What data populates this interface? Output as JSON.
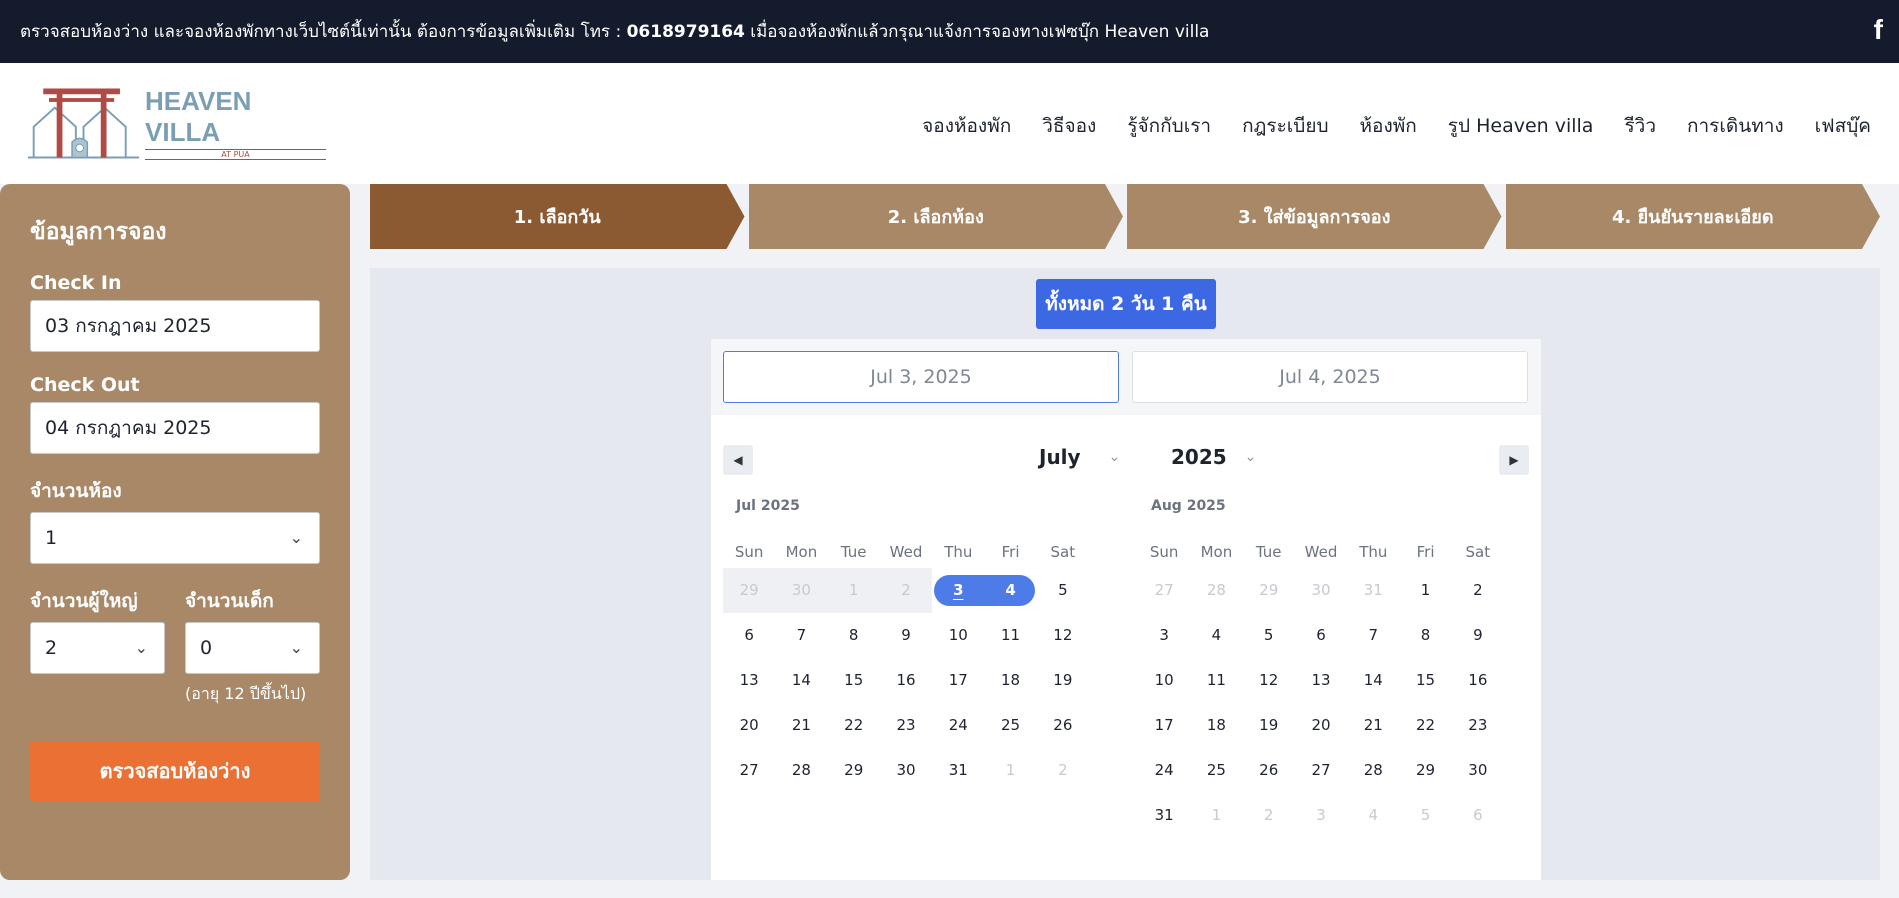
{
  "topbar": {
    "notice_prefix": "ตรวจสอบห้องว่าง และจองห้องพักทางเว็บไซต์นี้เท่านั้น ต้องการข้อมูลเพิ่มเติม โทร : ",
    "phone": "0618979164",
    "notice_suffix": " เมื่อจองห้องพักแล้วกรุณาแจ้งการจองทางเฟซบุ๊ก Heaven villa",
    "facebook_icon": "f"
  },
  "logo": {
    "title": "HEAVEN VILLA",
    "subtitle": "AT PUA"
  },
  "nav": [
    "จองห้องพัก",
    "วิธีจอง",
    "รู้จักกับเรา",
    "กฎระเบียบ",
    "ห้องพัก",
    "รูป Heaven villa",
    "รีวิว",
    "การเดินทาง",
    "เฟสบุ๊ค"
  ],
  "sidebar": {
    "title": "ข้อมูลการจอง",
    "checkin_label": "Check In",
    "checkin_value": "03 กรกฎาคม 2025",
    "checkout_label": "Check Out",
    "checkout_value": "04 กรกฎาคม 2025",
    "rooms_label": "จำนวนห้อง",
    "rooms_value": "1",
    "adults_label": "จำนวนผู้ใหญ่",
    "adults_value": "2",
    "children_label": "จำนวนเด็ก",
    "children_value": "0",
    "age_note": "(อายุ 12 ปีขึ้นไป)",
    "check_button": "ตรวจสอบห้องว่าง"
  },
  "steps": [
    "1. เลือกวัน",
    "2. เลือกห้อง",
    "3. ใส่ข้อมูลการจอง",
    "4. ยืนยันรายละเอียด"
  ],
  "active_step": 0,
  "booking": {
    "nights_badge": "ทั้งหมด 2 วัน 1 คืน",
    "start_input": "Jul 3, 2025",
    "end_input": "Jul 4, 2025"
  },
  "calendar": {
    "month_select": "July",
    "year_select": "2025",
    "dow": [
      "Sun",
      "Mon",
      "Tue",
      "Wed",
      "Thu",
      "Fri",
      "Sat"
    ],
    "months": [
      {
        "title": "Jul 2025",
        "weeks": [
          [
            {
              "d": "29",
              "s": "past"
            },
            {
              "d": "30",
              "s": "past"
            },
            {
              "d": "1",
              "s": "past"
            },
            {
              "d": "2",
              "s": "past"
            },
            {
              "d": "3",
              "s": "selstart"
            },
            {
              "d": "4",
              "s": "selend"
            },
            {
              "d": "5",
              "s": ""
            }
          ],
          [
            {
              "d": "6",
              "s": ""
            },
            {
              "d": "7",
              "s": ""
            },
            {
              "d": "8",
              "s": ""
            },
            {
              "d": "9",
              "s": ""
            },
            {
              "d": "10",
              "s": ""
            },
            {
              "d": "11",
              "s": ""
            },
            {
              "d": "12",
              "s": ""
            }
          ],
          [
            {
              "d": "13",
              "s": ""
            },
            {
              "d": "14",
              "s": ""
            },
            {
              "d": "15",
              "s": ""
            },
            {
              "d": "16",
              "s": ""
            },
            {
              "d": "17",
              "s": ""
            },
            {
              "d": "18",
              "s": ""
            },
            {
              "d": "19",
              "s": ""
            }
          ],
          [
            {
              "d": "20",
              "s": ""
            },
            {
              "d": "21",
              "s": ""
            },
            {
              "d": "22",
              "s": ""
            },
            {
              "d": "23",
              "s": ""
            },
            {
              "d": "24",
              "s": ""
            },
            {
              "d": "25",
              "s": ""
            },
            {
              "d": "26",
              "s": ""
            }
          ],
          [
            {
              "d": "27",
              "s": ""
            },
            {
              "d": "28",
              "s": ""
            },
            {
              "d": "29",
              "s": ""
            },
            {
              "d": "30",
              "s": ""
            },
            {
              "d": "31",
              "s": ""
            },
            {
              "d": "1",
              "s": "muted"
            },
            {
              "d": "2",
              "s": "muted"
            }
          ]
        ]
      },
      {
        "title": "Aug 2025",
        "weeks": [
          [
            {
              "d": "27",
              "s": "muted"
            },
            {
              "d": "28",
              "s": "muted"
            },
            {
              "d": "29",
              "s": "muted"
            },
            {
              "d": "30",
              "s": "muted"
            },
            {
              "d": "31",
              "s": "muted"
            },
            {
              "d": "1",
              "s": ""
            },
            {
              "d": "2",
              "s": ""
            }
          ],
          [
            {
              "d": "3",
              "s": ""
            },
            {
              "d": "4",
              "s": ""
            },
            {
              "d": "5",
              "s": ""
            },
            {
              "d": "6",
              "s": ""
            },
            {
              "d": "7",
              "s": ""
            },
            {
              "d": "8",
              "s": ""
            },
            {
              "d": "9",
              "s": ""
            }
          ],
          [
            {
              "d": "10",
              "s": ""
            },
            {
              "d": "11",
              "s": ""
            },
            {
              "d": "12",
              "s": ""
            },
            {
              "d": "13",
              "s": ""
            },
            {
              "d": "14",
              "s": ""
            },
            {
              "d": "15",
              "s": ""
            },
            {
              "d": "16",
              "s": ""
            }
          ],
          [
            {
              "d": "17",
              "s": ""
            },
            {
              "d": "18",
              "s": ""
            },
            {
              "d": "19",
              "s": ""
            },
            {
              "d": "20",
              "s": ""
            },
            {
              "d": "21",
              "s": ""
            },
            {
              "d": "22",
              "s": ""
            },
            {
              "d": "23",
              "s": ""
            }
          ],
          [
            {
              "d": "24",
              "s": ""
            },
            {
              "d": "25",
              "s": ""
            },
            {
              "d": "26",
              "s": ""
            },
            {
              "d": "27",
              "s": ""
            },
            {
              "d": "28",
              "s": ""
            },
            {
              "d": "29",
              "s": ""
            },
            {
              "d": "30",
              "s": ""
            }
          ],
          [
            {
              "d": "31",
              "s": ""
            },
            {
              "d": "1",
              "s": "muted"
            },
            {
              "d": "2",
              "s": "muted"
            },
            {
              "d": "3",
              "s": "muted"
            },
            {
              "d": "4",
              "s": "muted"
            },
            {
              "d": "5",
              "s": "muted"
            },
            {
              "d": "6",
              "s": "muted"
            }
          ]
        ]
      }
    ]
  },
  "colors": {
    "topbar_bg": "#141b2d",
    "sidebar_bg": "#a88866",
    "step_active": "#8b5a32",
    "accent_blue": "#3c68e4",
    "check_button": "#ea7033"
  }
}
